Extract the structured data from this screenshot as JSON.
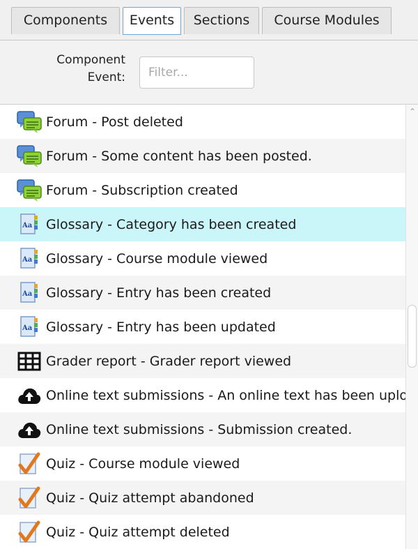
{
  "tabs": [
    {
      "label": "Components",
      "active": false
    },
    {
      "label": "Events",
      "active": true
    },
    {
      "label": "Sections",
      "active": false
    },
    {
      "label": "Course Modules",
      "active": false
    }
  ],
  "filter": {
    "label": "Component\nEvent:",
    "placeholder": "Filter...",
    "value": ""
  },
  "events": [
    {
      "icon": "forum-icon",
      "label": "Forum - Post deleted"
    },
    {
      "icon": "forum-icon",
      "label": "Forum - Some content has been posted."
    },
    {
      "icon": "forum-icon",
      "label": "Forum - Subscription created"
    },
    {
      "icon": "glossary-icon",
      "label": "Glossary - Category has been created",
      "selected": true
    },
    {
      "icon": "glossary-icon",
      "label": "Glossary - Course module viewed"
    },
    {
      "icon": "glossary-icon",
      "label": "Glossary - Entry has been created"
    },
    {
      "icon": "glossary-icon",
      "label": "Glossary - Entry has been updated"
    },
    {
      "icon": "grader-table-icon",
      "label": "Grader report - Grader report viewed"
    },
    {
      "icon": "cloud-upload-icon",
      "label": "Online text submissions - An online text has been uploaded."
    },
    {
      "icon": "cloud-upload-icon",
      "label": "Online text submissions - Submission created."
    },
    {
      "icon": "quiz-check-icon",
      "label": "Quiz - Course module viewed"
    },
    {
      "icon": "quiz-check-icon",
      "label": "Quiz - Quiz attempt abandoned"
    },
    {
      "icon": "quiz-check-icon",
      "label": "Quiz - Quiz attempt deleted"
    }
  ],
  "scrollbar": {
    "up_arrow_icon": "chevron-up-icon",
    "thumb_position": 0.45
  }
}
